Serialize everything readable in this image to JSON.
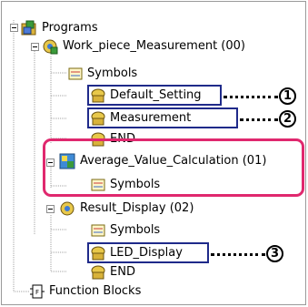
{
  "tree": {
    "programs": "Programs",
    "work_piece": "Work_piece_Measurement (00)",
    "symbols1": "Symbols",
    "default_setting": "Default_Setting",
    "measurement": "Measurement",
    "end1": "END",
    "average": "Average_Value_Calculation (01)",
    "symbols2": "Symbols",
    "result": "Result_Display (02)",
    "symbols3": "Symbols",
    "led_display": "LED_Display",
    "end2": "END",
    "function_blocks": "Function Blocks"
  },
  "callouts": {
    "c1": "1",
    "c2": "2",
    "c3": "3"
  },
  "colors": {
    "highlight": "#e0286e",
    "selection_box": "#1f2a8a"
  }
}
